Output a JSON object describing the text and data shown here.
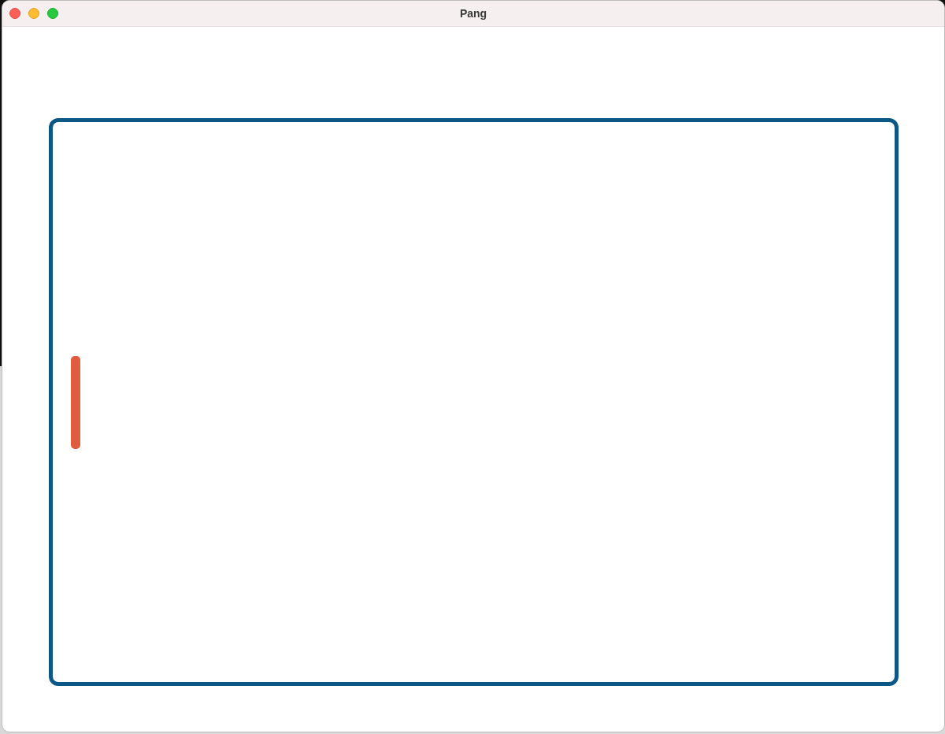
{
  "window": {
    "title": "Pang"
  }
}
